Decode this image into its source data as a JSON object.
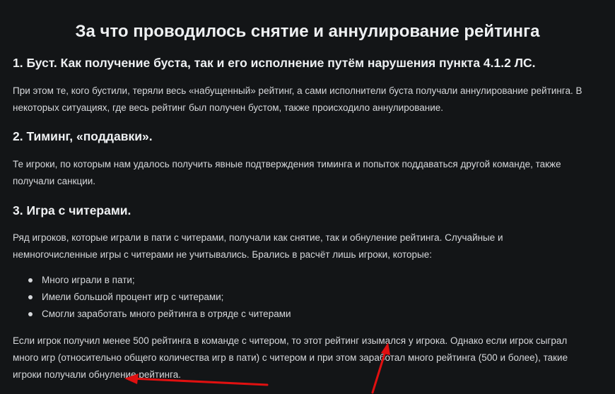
{
  "article": {
    "title": "За что проводилось снятие и аннулирование рейтинга",
    "section1": {
      "heading": "1. Буст. Как получение буста, так и его исполнение путём нарушения пункта 4.1.2 ЛС.",
      "lines": [
        "При этом те, кого бустили, теряли весь «набущенный» рейтинг, а сами исполнители буста получали аннулирование рейтинга. В",
        "некоторых ситуациях, где весь рейтинг был получен бустом, также происходило аннулирование."
      ]
    },
    "section2": {
      "heading": "2. Тиминг, «поддавки».",
      "lines": [
        "Те игроки, по которым нам удалось получить явные подтверждения тиминга и попыток поддаваться другой команде, также",
        "получали санкции."
      ]
    },
    "section3": {
      "heading": "3. Игра с читерами.",
      "lines": [
        "Ряд игроков, которые играли в пати с читерами, получали как снятие, так и обнуление рейтинга. Случайные и",
        "немногочисленные игры с читерами не учитывались. Брались в расчёт лишь игроки, которые:"
      ],
      "bullets": [
        "Много играли в пати;",
        "Имели большой процент игр с читерами;",
        "Смогли заработать много рейтинга в отряде с читерами"
      ],
      "closing_lines": [
        "Если игрок получил менее 500 рейтинга в команде с читером, то этот рейтинг изымался у игрока. Однако если игрок сыграл",
        "много игр (относительно общего количества игр в пати) с читером и при этом заработал много рейтинга (500 и более), такие",
        "игроки получали обнуление рейтинга."
      ]
    }
  },
  "colors": {
    "background": "#131517",
    "text": "#d6d8db",
    "heading": "#eef0f2",
    "annotation_arrow": "#e01010"
  }
}
